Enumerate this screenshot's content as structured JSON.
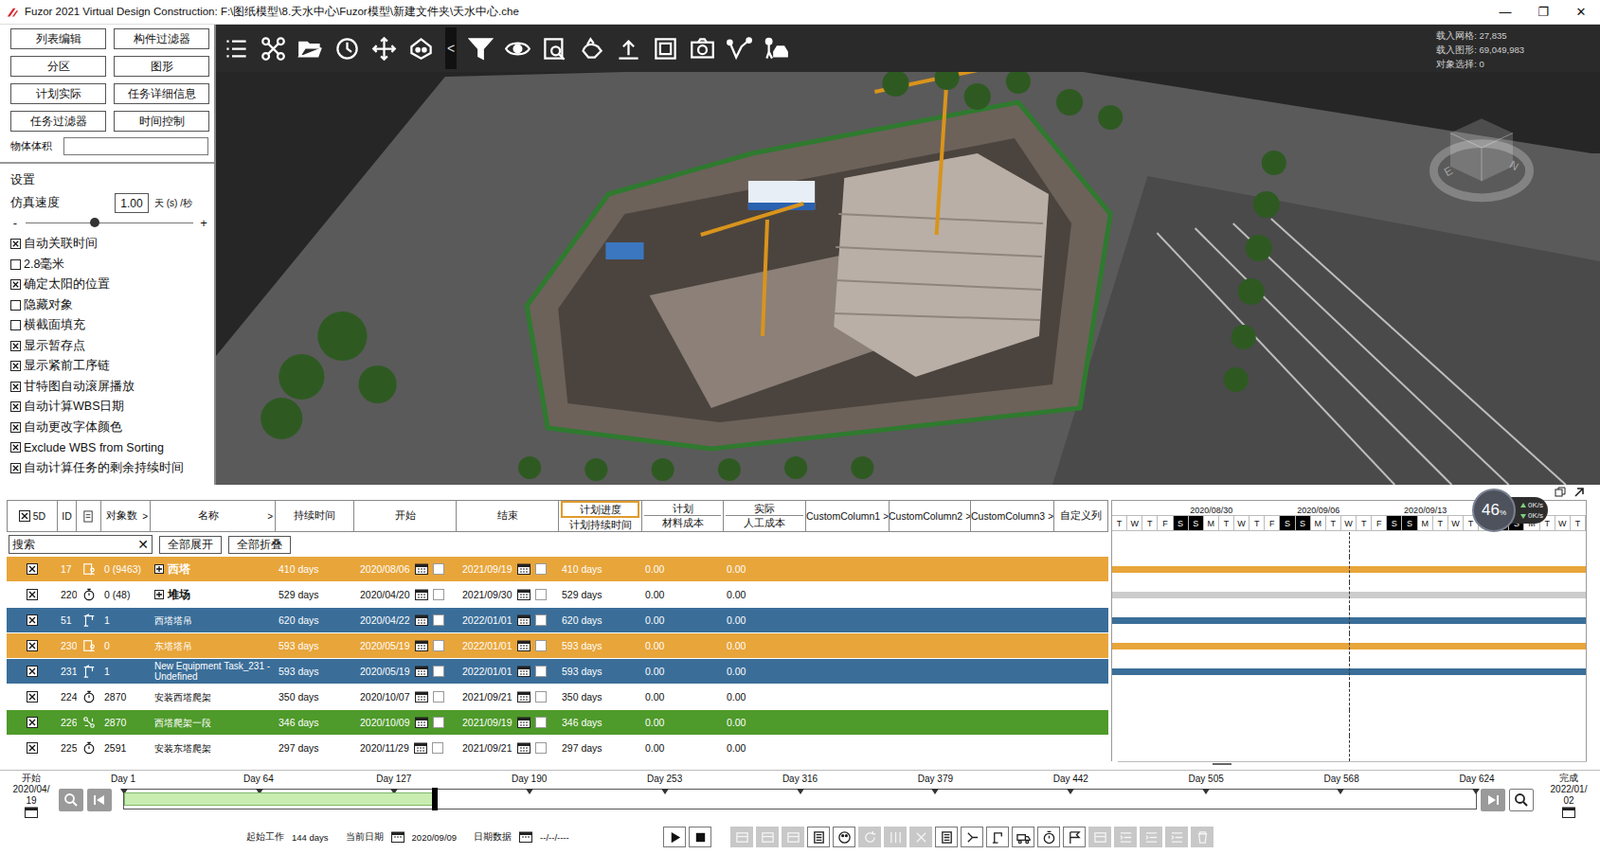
{
  "window": {
    "title": "Fuzor 2021 Virtual Design Construction: F:\\图纸模型\\8.天水中心\\Fuzor模型\\新建文件夹\\天水中心.che",
    "controls": [
      "—",
      "❐",
      "✕"
    ]
  },
  "panel": {
    "buttons": [
      {
        "label": "列表编辑"
      },
      {
        "label": "构件过滤器"
      },
      {
        "label": "分区"
      },
      {
        "label": "图形"
      },
      {
        "label": "计划实际"
      },
      {
        "label": "任务详细信息"
      },
      {
        "label": "任务过滤器"
      },
      {
        "label": "时间控制"
      }
    ],
    "volume": {
      "label": "物体体积",
      "value": ""
    },
    "settings_title": "设置",
    "speed": {
      "label": "仿真速度",
      "value": "1.00",
      "unit": "天 (s) /秒",
      "minus": "-",
      "plus": "+",
      "level": 0.41
    },
    "options": [
      {
        "label": "自动关联时间",
        "checked": true
      },
      {
        "label": "2.8毫米",
        "checked": false
      },
      {
        "label": "确定太阳的位置",
        "checked": true
      },
      {
        "label": "隐藏对象",
        "checked": false
      },
      {
        "label": "横截面填充",
        "checked": false
      },
      {
        "label": "显示暂存点",
        "checked": true
      },
      {
        "label": "显示紧前工序链",
        "checked": true
      },
      {
        "label": "甘特图自动滚屏播放",
        "checked": true
      },
      {
        "label": "自动计算WBS日期",
        "checked": true
      },
      {
        "label": "自动更改字体颜色",
        "checked": true
      },
      {
        "label": "Exclude WBS from Sorting",
        "checked": true
      },
      {
        "label": "自动计算任务的剩余持续时间",
        "checked": true
      }
    ]
  },
  "viewport": {
    "collapse": "<",
    "stats": [
      "载入网格: 27,835",
      "载入图形: 69,049,983",
      "对象选择: 0"
    ],
    "compass": [
      "E",
      "N"
    ]
  },
  "table": {
    "columns": [
      {
        "kind": "check",
        "label": "5D",
        "checked": true,
        "selected": false
      },
      {
        "kind": "text",
        "label": "ID",
        "selected": false
      },
      {
        "kind": "icon",
        "selected": false
      },
      {
        "kind": "text",
        "label": "对象数",
        "arrow": ">",
        "selected": false
      },
      {
        "kind": "text",
        "label": "名称",
        "arrow": ">",
        "selected": false
      },
      {
        "kind": "text",
        "label": "持续时间",
        "selected": false
      },
      {
        "kind": "text",
        "label": "开始",
        "selected": false
      },
      {
        "kind": "text",
        "label": "结束",
        "selected": false
      },
      {
        "kind": "text",
        "label": "计划进度",
        "sub": "计划持续时间",
        "selected": true
      },
      {
        "kind": "text",
        "label": "计划",
        "sub": "材料成本",
        "selected": false
      },
      {
        "kind": "text",
        "label": "实际",
        "sub": "人工成本",
        "selected": false
      },
      {
        "kind": "text",
        "label": "CustomColumn1",
        "arrow": ">",
        "selected": false
      },
      {
        "kind": "text",
        "label": "CustomColumn2",
        "arrow": ">",
        "selected": false
      },
      {
        "kind": "text",
        "label": "CustomColumn3",
        "arrow": ">",
        "selected": false
      },
      {
        "kind": "text",
        "label": "自定义列",
        "selected": false
      }
    ],
    "search": {
      "placeholder": "搜索",
      "clear": "✕"
    },
    "buttons": [
      "全部展开",
      "全部折叠"
    ],
    "rows": [
      {
        "id": "17",
        "kind": "task",
        "count": "0 (9463)",
        "name": "西塔",
        "group": true,
        "expanded": false,
        "duration": "410 days",
        "start": "2020/08/06",
        "start_locked": false,
        "end": "2021/09/19",
        "end_locked": false,
        "plan_duration": "410 days",
        "material_cost": "0.00",
        "labor_cost": "0.00",
        "visible": true,
        "color": "#E8A53A",
        "bar": "#E8A53A"
      },
      {
        "id": "220",
        "kind": "timer",
        "count": "0 (48)",
        "name": "堆场",
        "group": true,
        "expanded": false,
        "duration": "529 days",
        "start": "2020/04/20",
        "start_locked": false,
        "end": "2021/09/30",
        "end_locked": false,
        "plan_duration": "529 days",
        "material_cost": "0.00",
        "labor_cost": "0.00",
        "visible": true,
        "color": "#FFFFFF",
        "bar": "#CCCCCC"
      },
      {
        "id": "51",
        "kind": "equipment",
        "count": "1",
        "name": "西塔塔吊",
        "group": false,
        "expanded": false,
        "duration": "620 days",
        "start": "2020/04/22",
        "start_locked": false,
        "end": "2022/01/01",
        "end_locked": false,
        "plan_duration": "620 days",
        "material_cost": "0.00",
        "labor_cost": "0.00",
        "visible": true,
        "color": "#3A6E99",
        "bar": "#3A6E99"
      },
      {
        "id": "230",
        "kind": "task",
        "count": "0",
        "name": "东塔塔吊",
        "group": false,
        "expanded": false,
        "duration": "593 days",
        "start": "2020/05/19",
        "start_locked": false,
        "end": "2022/01/01",
        "end_locked": false,
        "plan_duration": "593 days",
        "material_cost": "0.00",
        "labor_cost": "0.00",
        "visible": true,
        "color": "#E8A53A",
        "bar": "#E8A53A"
      },
      {
        "id": "231",
        "kind": "equipment",
        "count": "1",
        "name": "New Equipment Task_231 - Undefined",
        "group": false,
        "expanded": false,
        "duration": "593 days",
        "start": "2020/05/19",
        "start_locked": false,
        "end": "2022/01/01",
        "end_locked": false,
        "plan_duration": "593 days",
        "material_cost": "0.00",
        "labor_cost": "0.00",
        "visible": true,
        "color": "#3A6E99",
        "bar": "#3A6E99"
      },
      {
        "id": "224",
        "kind": "timer",
        "count": "2870",
        "name": "安装西塔爬架",
        "group": false,
        "expanded": false,
        "duration": "350 days",
        "start": "2020/10/07",
        "start_locked": false,
        "end": "2021/09/21",
        "end_locked": false,
        "plan_duration": "350 days",
        "material_cost": "0.00",
        "labor_cost": "0.00",
        "visible": true,
        "color": "#FFFFFF",
        "bar": null
      },
      {
        "id": "226",
        "kind": "motion",
        "count": "2870",
        "name": "西塔爬架一段",
        "group": false,
        "expanded": false,
        "duration": "346 days",
        "start": "2020/10/09",
        "start_locked": false,
        "end": "2021/09/19",
        "end_locked": false,
        "plan_duration": "346 days",
        "material_cost": "0.00",
        "labor_cost": "0.00",
        "visible": true,
        "color": "#4E9A2A",
        "bar": null
      },
      {
        "id": "225",
        "kind": "timer",
        "count": "2591",
        "name": "安装东塔爬架",
        "group": false,
        "expanded": false,
        "duration": "297 days",
        "start": "2020/11/29",
        "start_locked": false,
        "end": "2021/09/21",
        "end_locked": false,
        "plan_duration": "297 days",
        "material_cost": "0.00",
        "labor_cost": "0.00",
        "visible": true,
        "color": "#FFFFFF",
        "bar": null
      }
    ]
  },
  "gantt": {
    "weeks": [
      "2020/08/30",
      "2020/09/06",
      "2020/09/13"
    ],
    "days": [
      {
        "d": "T",
        "weekend": false
      },
      {
        "d": "W",
        "weekend": false
      },
      {
        "d": "T",
        "weekend": false
      },
      {
        "d": "F",
        "weekend": false
      },
      {
        "d": "S",
        "weekend": true
      },
      {
        "d": "S",
        "weekend": true
      },
      {
        "d": "M",
        "weekend": false
      },
      {
        "d": "T",
        "weekend": false
      },
      {
        "d": "W",
        "weekend": false
      },
      {
        "d": "T",
        "weekend": false
      },
      {
        "d": "F",
        "weekend": false
      },
      {
        "d": "S",
        "weekend": true
      },
      {
        "d": "S",
        "weekend": true
      },
      {
        "d": "M",
        "weekend": false
      },
      {
        "d": "T",
        "weekend": false
      },
      {
        "d": "W",
        "weekend": false
      },
      {
        "d": "T",
        "weekend": false
      },
      {
        "d": "F",
        "weekend": false
      },
      {
        "d": "S",
        "weekend": true
      },
      {
        "d": "S",
        "weekend": true
      },
      {
        "d": "M",
        "weekend": false
      },
      {
        "d": "T",
        "weekend": false
      },
      {
        "d": "W",
        "weekend": false
      },
      {
        "d": "T",
        "weekend": false
      },
      {
        "d": "F",
        "weekend": false
      },
      {
        "d": "S",
        "weekend": true
      },
      {
        "d": "S",
        "weekend": true
      },
      {
        "d": "M",
        "weekend": false
      },
      {
        "d": "T",
        "weekend": false
      },
      {
        "d": "W",
        "weekend": false
      },
      {
        "d": "T",
        "weekend": false
      }
    ],
    "today": 0.5
  },
  "progress": {
    "percent": "46",
    "unit": "%",
    "up": "0K/s",
    "down": "0K/s"
  },
  "timeline": {
    "start_label": "开始",
    "start_date": "2020/04/19",
    "end_label": "完成",
    "end_date": "2022/01/02",
    "days": [
      "Day 1",
      "Day 64",
      "Day 127",
      "Day 190",
      "Day 253",
      "Day 316",
      "Day 379",
      "Day 442",
      "Day 505",
      "Day 568",
      "Day 624"
    ],
    "level": 0.23,
    "status": [
      {
        "label": "起始工作",
        "value": "144 days",
        "calendar": false
      },
      {
        "label": "当前日期",
        "value": "2020/09/09",
        "calendar": true
      },
      {
        "label": "日期数据",
        "value": "--/--/----",
        "calendar": true
      }
    ],
    "tools": [
      {
        "kind": "box",
        "disabled": true
      },
      {
        "kind": "box",
        "disabled": true
      },
      {
        "kind": "box",
        "disabled": true
      },
      {
        "kind": "doc",
        "disabled": false
      },
      {
        "kind": "palette",
        "disabled": false
      },
      {
        "kind": "refresh",
        "disabled": true
      },
      {
        "kind": "columns",
        "disabled": true
      },
      {
        "kind": "cancel",
        "disabled": true
      },
      {
        "kind": "doc",
        "disabled": false
      },
      {
        "kind": "link",
        "disabled": false
      },
      {
        "kind": "equip",
        "disabled": false
      },
      {
        "kind": "truck",
        "disabled": false
      },
      {
        "kind": "timer",
        "disabled": false
      },
      {
        "kind": "flag",
        "disabled": false
      },
      {
        "kind": "box",
        "disabled": true
      },
      {
        "kind": "indent",
        "disabled": true
      },
      {
        "kind": "indent",
        "disabled": true
      },
      {
        "kind": "indent",
        "disabled": true
      },
      {
        "kind": "trash",
        "disabled": true
      }
    ]
  }
}
